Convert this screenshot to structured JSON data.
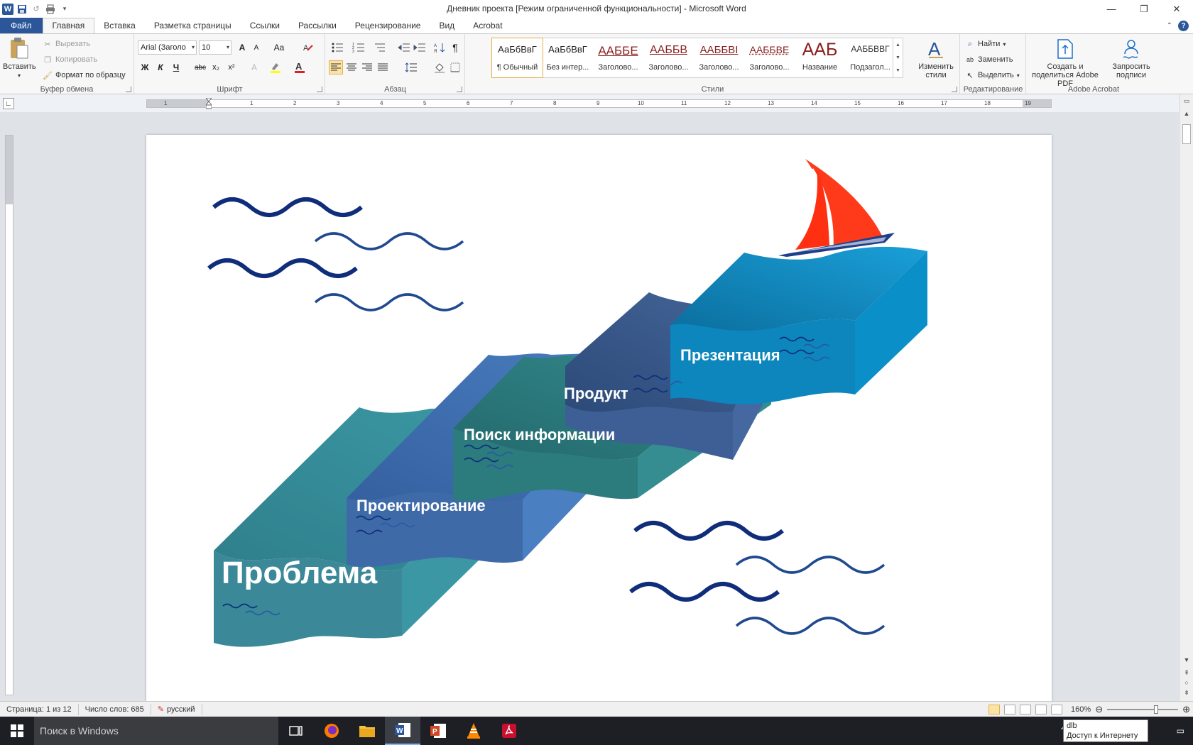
{
  "window": {
    "title": "Дневник проекта [Режим ограниченной функциональности] - Microsoft Word",
    "minimize": "—",
    "restore": "❐",
    "close": "✕"
  },
  "tabs": [
    "Файл",
    "Главная",
    "Вставка",
    "Разметка страницы",
    "Ссылки",
    "Рассылки",
    "Рецензирование",
    "Вид",
    "Acrobat"
  ],
  "ribbon": {
    "clipboard": {
      "label": "Буфер обмена",
      "paste": "Вставить",
      "cut": "Вырезать",
      "copy": "Копировать",
      "format_painter": "Формат по образцу"
    },
    "font": {
      "label": "Шрифт",
      "font_name": "Arial (Заголо",
      "font_size": "10",
      "bold": "Ж",
      "italic": "К",
      "underline": "Ч",
      "strike": "abc",
      "subscript": "x₂",
      "superscript": "x²",
      "grow": "A",
      "shrink": "A",
      "case": "Aa"
    },
    "paragraph": {
      "label": "Абзац"
    },
    "styles": {
      "label": "Стили",
      "items": [
        {
          "sample": "АаБбВвГ",
          "name": "¶ Обычный",
          "color": "#222222"
        },
        {
          "sample": "АаБбВвГ",
          "name": "Без интер...",
          "color": "#222222"
        },
        {
          "sample": "ААББЕ",
          "name": "Заголово...",
          "color": "#8a1f1f"
        },
        {
          "sample": "ААББВ",
          "name": "Заголово...",
          "color": "#8a1f1f"
        },
        {
          "sample": "ААББВІ",
          "name": "Заголово...",
          "color": "#8a1f1f"
        },
        {
          "sample": "ААББВЕ",
          "name": "Заголово...",
          "color": "#8a1f1f"
        },
        {
          "sample": "ААБ",
          "name": "Название",
          "color": "#8a1f1f"
        },
        {
          "sample": "ААББВВГ",
          "name": "Подзагол...",
          "color": "#333333"
        }
      ],
      "change_styles": "Изменить стили"
    },
    "editing": {
      "label": "Редактирование",
      "find": "Найти",
      "replace": "Заменить",
      "select": "Выделить"
    },
    "acrobat": {
      "label": "Adobe Acrobat",
      "create_share": "Создать и поделиться Adobe PDF",
      "request_sign": "Запросить подписи"
    }
  },
  "ruler": {
    "numbers": [
      "1",
      "1",
      "2",
      "3",
      "4",
      "5",
      "6",
      "7",
      "8",
      "9",
      "10",
      "11",
      "12",
      "13",
      "14",
      "15",
      "16",
      "17",
      "18",
      "19"
    ]
  },
  "document": {
    "steps": [
      {
        "label": "Проблема",
        "color": "#3a8fa0"
      },
      {
        "label": "Проектирование",
        "color": "#3a6fb5"
      },
      {
        "label": "Поиск информации",
        "color": "#2f7f82"
      },
      {
        "label": "Продукт",
        "color": "#3d5f95"
      },
      {
        "label": "Презентация",
        "color": "#0a8fc8"
      }
    ],
    "sail_color": "#ff3a1a",
    "wave_color": "#0f2d7a"
  },
  "status": {
    "page": "Страница: 1 из 12",
    "words": "Число слов: 685",
    "language": "русский",
    "zoom": "160%"
  },
  "taskbar": {
    "search": "Поиск в Windows",
    "tooltip_line1": "dlb",
    "tooltip_line2": "Доступ к Интернету"
  }
}
